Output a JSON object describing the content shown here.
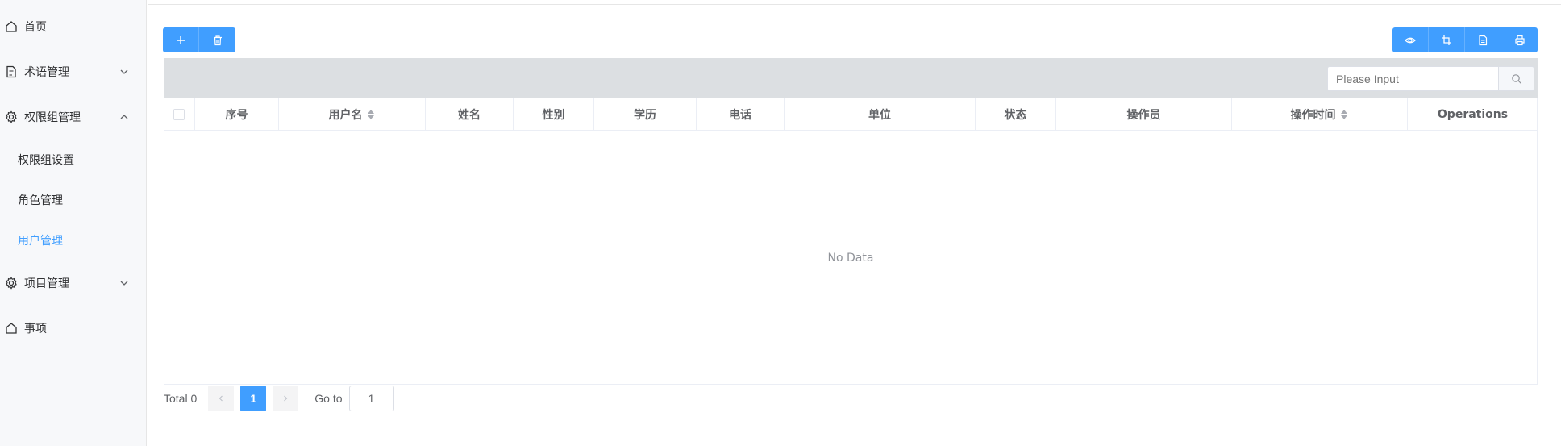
{
  "sidebar": {
    "items": [
      {
        "label": "首页",
        "icon": "home-icon"
      },
      {
        "label": "术语管理",
        "icon": "document-icon",
        "arrow": "chevron-down-icon"
      },
      {
        "label": "权限组管理",
        "icon": "gear-icon",
        "arrow": "chevron-up-icon"
      },
      {
        "label": "项目管理",
        "icon": "gear-icon",
        "arrow": "chevron-down-icon"
      },
      {
        "label": "事项",
        "icon": "home-icon"
      }
    ],
    "submenu": [
      {
        "label": "权限组设置",
        "active": false
      },
      {
        "label": "角色管理",
        "active": false
      },
      {
        "label": "用户管理",
        "active": true
      }
    ]
  },
  "toolbar": {
    "left_buttons": [
      "plus-icon",
      "trash-icon"
    ],
    "right_buttons": [
      "eye-icon",
      "crop-icon",
      "export-document-icon",
      "printer-icon"
    ]
  },
  "search": {
    "placeholder": "Please Input",
    "button_icon": "search-icon"
  },
  "table": {
    "columns": [
      "序号",
      "用户名",
      "姓名",
      "性别",
      "学历",
      "电话",
      "单位",
      "状态",
      "操作员",
      "操作时间",
      "Operations"
    ],
    "sortable": [
      "用户名",
      "操作时间"
    ],
    "rows": [],
    "empty_text": "No Data"
  },
  "pagination": {
    "total_label": "Total 0",
    "current_page": "1",
    "prev_icon": "chevron-left-icon",
    "next_icon": "chevron-right-icon",
    "goto_label": "Go to",
    "goto_value": "1"
  },
  "colors": {
    "primary": "#409eff",
    "sidebar_bg": "#f7f8fa",
    "search_band": "#dcdfe2",
    "active_text": "#409eff"
  }
}
